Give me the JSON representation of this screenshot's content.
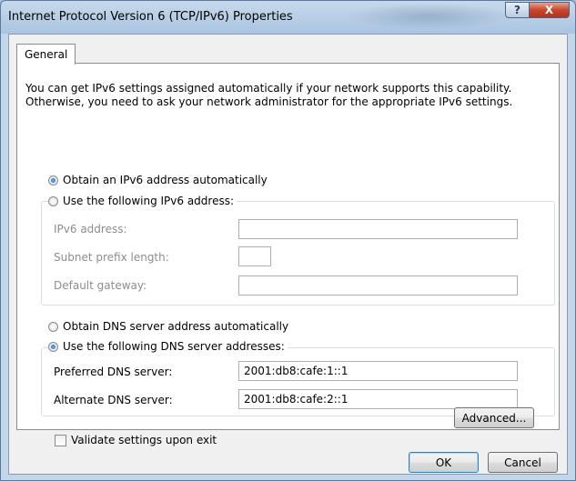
{
  "window": {
    "title": "Internet Protocol Version 6 (TCP/IPv6) Properties",
    "help_symbol": "?",
    "close_symbol": "X"
  },
  "tabs": [
    {
      "label": "General",
      "selected": true
    }
  ],
  "intro_text": "You can get IPv6 settings assigned automatically if your network supports this capability. Otherwise, you need to ask your network administrator for the appropriate IPv6 settings.",
  "ip_section": {
    "auto_label": "Obtain an IPv6 address automatically",
    "auto_checked": true,
    "manual_label": "Use the following IPv6 address:",
    "manual_checked": false,
    "fields": [
      {
        "label": "IPv6 address:",
        "value": ""
      },
      {
        "label": "Subnet prefix length:",
        "value": ""
      },
      {
        "label": "Default gateway:",
        "value": ""
      }
    ]
  },
  "dns_section": {
    "auto_label": "Obtain DNS server address automatically",
    "auto_checked": false,
    "manual_label": "Use the following DNS server addresses:",
    "manual_checked": true,
    "preferred_label": "Preferred DNS server:",
    "preferred_value": "2001:db8:cafe:1::1",
    "alternate_label": "Alternate DNS server:",
    "alternate_value": "2001:db8:cafe:2::1"
  },
  "validate_label": "Validate settings upon exit",
  "validate_checked": false,
  "buttons": {
    "advanced": "Advanced...",
    "ok": "OK",
    "cancel": "Cancel"
  }
}
